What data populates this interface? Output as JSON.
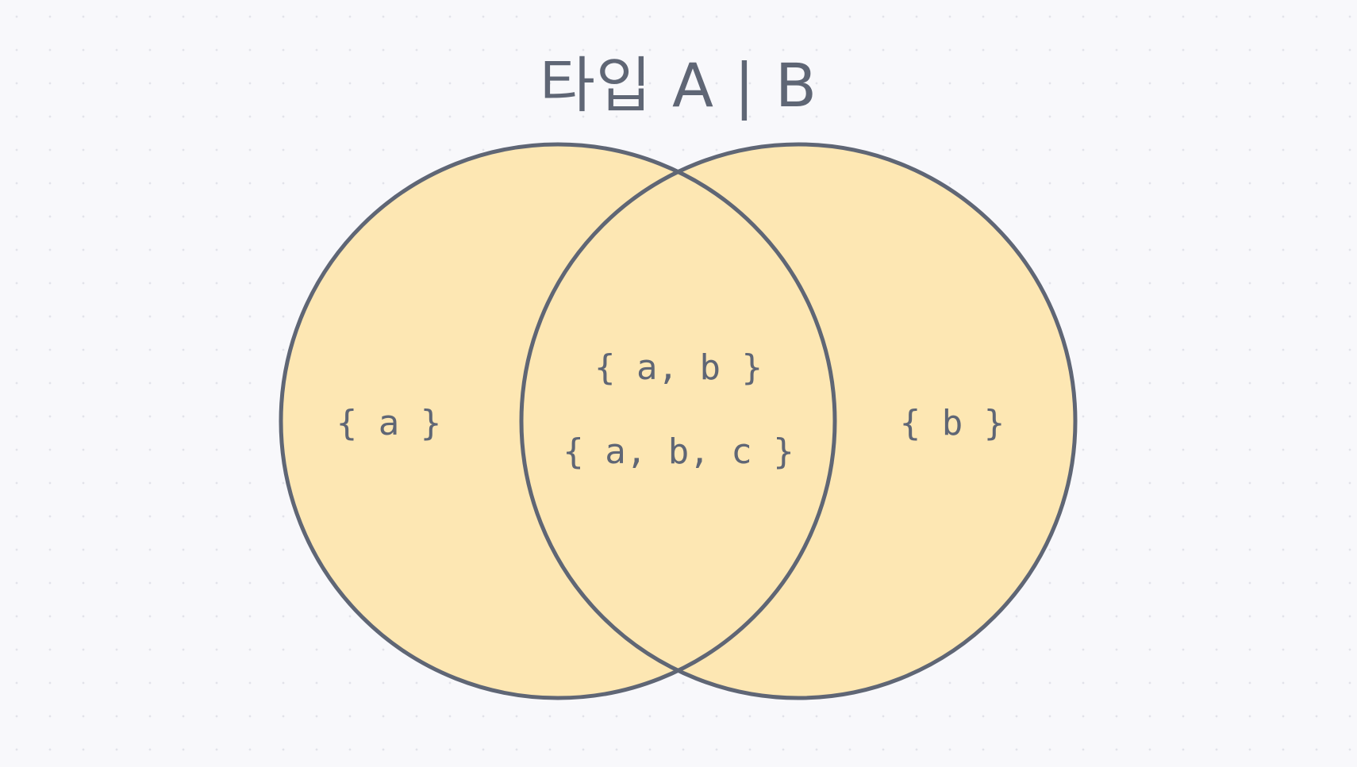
{
  "title": "타입 A | B",
  "colors": {
    "background": "#f8f8fb",
    "circle_fill": "#fde7b3",
    "circle_stroke": "#5f6675",
    "text": "#5f6675"
  },
  "sets": {
    "a": {
      "label": "{ a }"
    },
    "b": {
      "label": "{ b }"
    },
    "intersection": {
      "labels": [
        "{ a, b }",
        "{ a, b, c }"
      ]
    }
  }
}
